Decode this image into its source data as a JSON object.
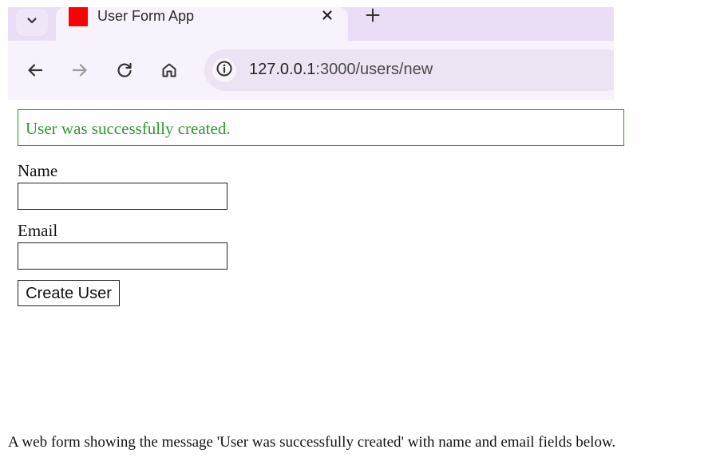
{
  "browser": {
    "tab": {
      "title": "User Form App",
      "favicon_color": "#ff0000"
    },
    "icons": {
      "tab_menu": "chevron-down-icon",
      "close": "close-icon",
      "new_tab": "plus-icon",
      "back": "arrow-left-icon",
      "forward": "arrow-right-icon",
      "reload": "reload-icon",
      "home": "home-icon",
      "site_info": "info-icon"
    },
    "address_bar": {
      "host": "127.0.0.1",
      "rest": ":3000/users/new"
    }
  },
  "page": {
    "notice": "User was successfully created.",
    "notice_color": "#2e9a2e",
    "form": {
      "name_label": "Name",
      "name_value": "",
      "email_label": "Email",
      "email_value": "",
      "submit_label": "Create User"
    }
  },
  "caption": "A web form showing the message 'User was successfully created' with name and email fields below."
}
